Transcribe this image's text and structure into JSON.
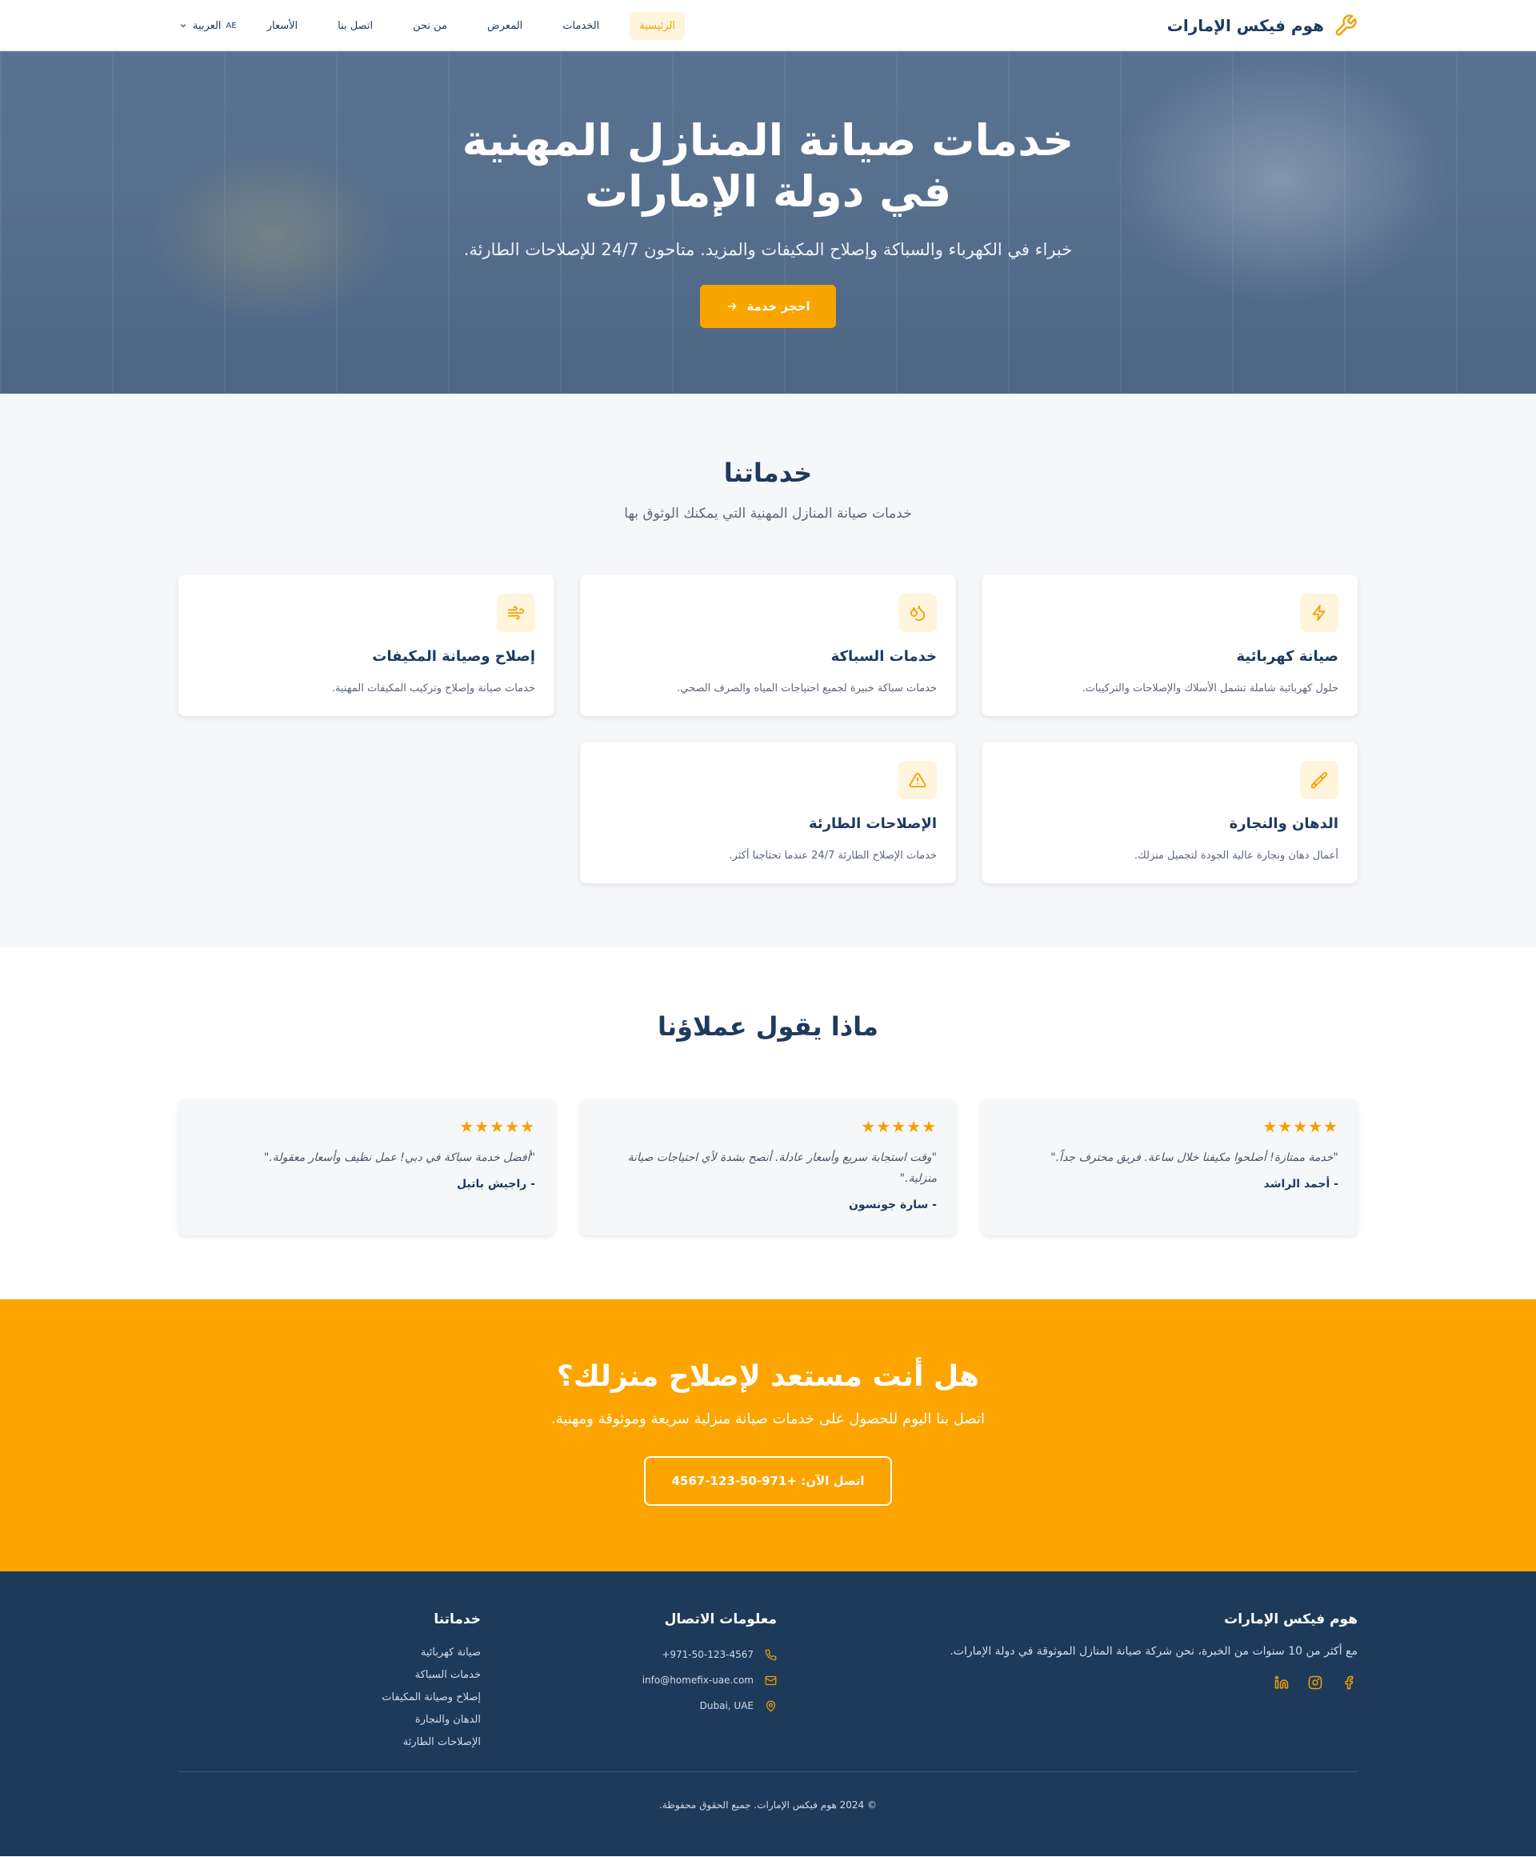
{
  "nav": {
    "brand": "هوم فيكس الإمارات",
    "items": [
      {
        "label": "الرئيسية",
        "active": true
      },
      {
        "label": "الخدمات",
        "active": false
      },
      {
        "label": "المعرض",
        "active": false
      },
      {
        "label": "من نحن",
        "active": false
      },
      {
        "label": "اتصل بنا",
        "active": false
      },
      {
        "label": "الأسعار",
        "active": false
      }
    ],
    "lang_flag": "AE",
    "lang_label": "العربية"
  },
  "hero": {
    "title": "خدمات صيانة المنازل المهنية في دولة الإمارات",
    "subtitle": "خبراء في الكهرباء والسباكة وإصلاح المكيفات والمزيد. متاحون 24/7 للإصلاحات الطارئة.",
    "cta": "احجز خدمة"
  },
  "services": {
    "title": "خدماتنا",
    "subtitle": "خدمات صيانة المنازل المهنية التي يمكنك الوثوق بها",
    "items": [
      {
        "icon": "bolt-icon",
        "title": "صيانة كهربائية",
        "desc": "حلول كهربائية شاملة تشمل الأسلاك والإصلاحات والتركيبات."
      },
      {
        "icon": "droplets-icon",
        "title": "خدمات السباكة",
        "desc": "خدمات سباكة خبيرة لجميع احتياجات المياه والصرف الصحي."
      },
      {
        "icon": "wind-icon",
        "title": "إصلاح وصيانة المكيفات",
        "desc": "خدمات صيانة وإصلاح وتركيب المكيفات المهنية."
      },
      {
        "icon": "paintbrush-icon",
        "title": "الدهان والنجارة",
        "desc": "أعمال دهان ونجارة عالية الجودة لتجميل منزلك."
      },
      {
        "icon": "alert-triangle-icon",
        "title": "الإصلاحات الطارئة",
        "desc": "خدمات الإصلاح الطارئة 24/7 عندما تحتاجنا أكثر."
      }
    ]
  },
  "testimonials": {
    "title": "ماذا يقول عملاؤنا",
    "items": [
      {
        "stars": "★★★★★",
        "quote": "\"خدمة ممتازة! أصلحوا مكيفنا خلال ساعة. فريق محترف جداً.\"",
        "author": "- أحمد الراشد"
      },
      {
        "stars": "★★★★★",
        "quote": "\"وقت استجابة سريع وأسعار عادلة. أنصح بشدة لأي احتياجات صيانة منزلية.\"",
        "author": "- سارة جونسون"
      },
      {
        "stars": "★★★★★",
        "quote": "\"أفضل خدمة سباكة في دبي! عمل نظيف وأسعار معقولة.\"",
        "author": "- راجيش باتيل"
      }
    ]
  },
  "cta": {
    "title": "هل أنت مستعد لإصلاح منزلك؟",
    "subtitle": "اتصل بنا اليوم للحصول على خدمات صيانة منزلية سريعة وموثوقة ومهنية.",
    "button": "اتصل الآن: +971-50-123-4567"
  },
  "footer": {
    "about_title": "هوم فيكس الإمارات",
    "about_text": "مع أكثر من 10 سنوات من الخبرة، نحن شركة صيانة المنازل الموثوقة في دولة الإمارات.",
    "contact_title": "معلومات الاتصال",
    "phone": "+971-50-123-4567",
    "email": "info@homefix-uae.com",
    "location": "Dubai, UAE",
    "services_title": "خدماتنا",
    "services": [
      "صيانة كهربائية",
      "خدمات السباكة",
      "إصلاح وصيانة المكيفات",
      "الدهان والنجارة",
      "الإصلاحات الطارئة"
    ],
    "copyright": "© 2024 هوم فيكس الإمارات. جميع الحقوق محفوظة."
  },
  "colors": {
    "accent": "#f8a500",
    "navy": "#1e3a5f",
    "footer_bg": "#1e3a5a"
  }
}
